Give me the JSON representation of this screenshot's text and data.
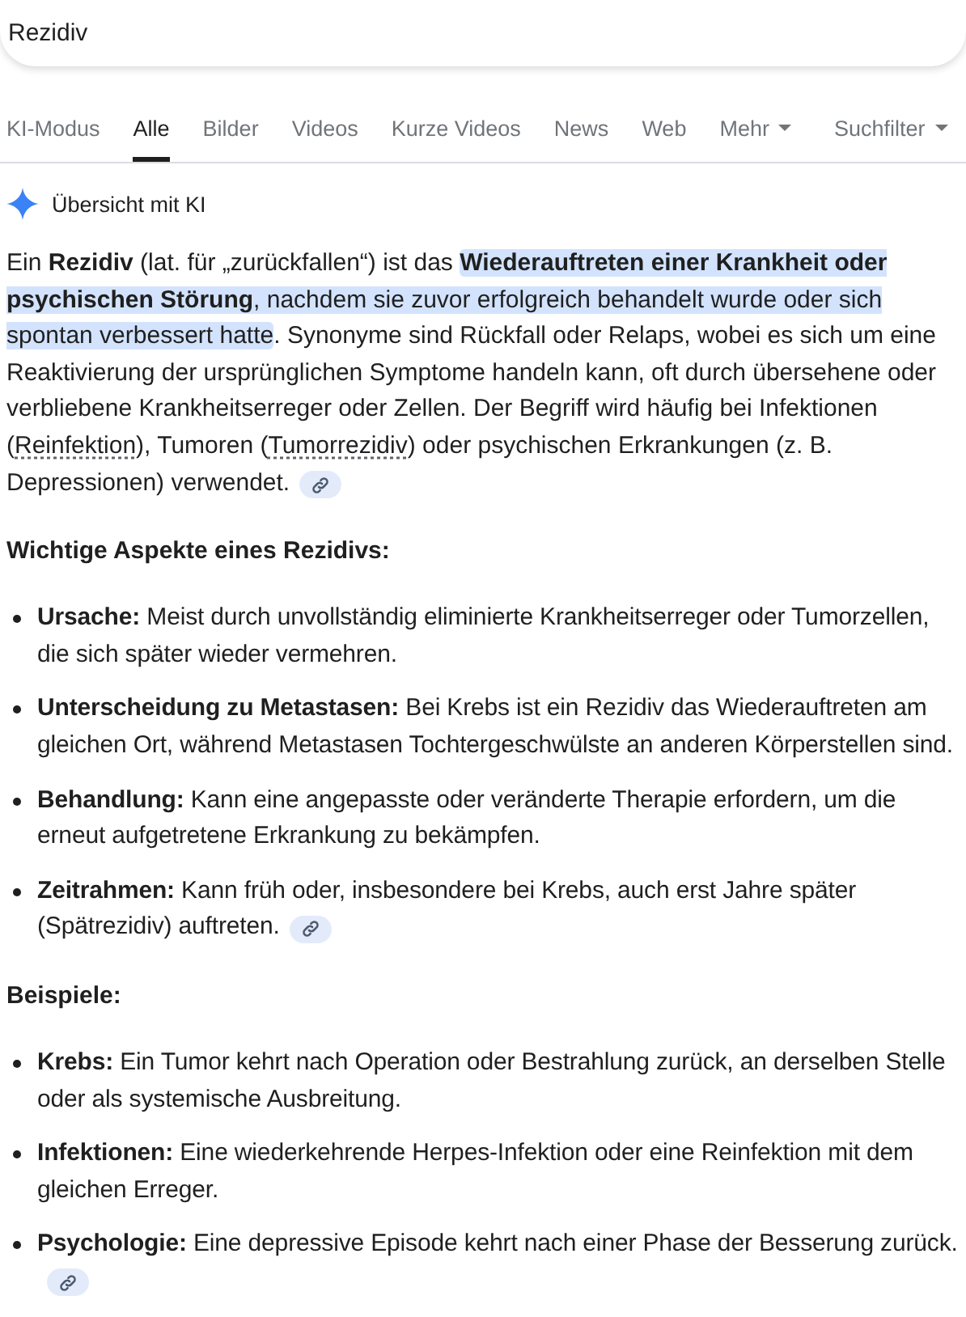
{
  "search": {
    "value": "Rezidiv"
  },
  "tabs": [
    {
      "label": "KI-Modus",
      "selected": false,
      "kind": "plain"
    },
    {
      "label": "Alle",
      "selected": true,
      "kind": "plain"
    },
    {
      "label": "Bilder",
      "selected": false,
      "kind": "plain"
    },
    {
      "label": "Videos",
      "selected": false,
      "kind": "plain"
    },
    {
      "label": "Kurze Videos",
      "selected": false,
      "kind": "plain"
    },
    {
      "label": "News",
      "selected": false,
      "kind": "plain"
    },
    {
      "label": "Web",
      "selected": false,
      "kind": "plain"
    },
    {
      "label": "Mehr",
      "selected": false,
      "kind": "dropdown"
    },
    {
      "label": "Suchfilter",
      "selected": false,
      "kind": "dropdown"
    }
  ],
  "overview": {
    "title": "Übersicht mit KI"
  },
  "intro": {
    "cited": true,
    "segments": [
      {
        "kind": "plain",
        "text": "Ein **Rezidiv** (lat. für „zurückfallen“) ist das "
      },
      {
        "kind": "highlight",
        "text": "**Wiederauftreten einer Krankheit oder psychischen Störung**, nachdem sie zuvor erfolgreich behandelt wurde oder sich spontan verbessert hatte"
      },
      {
        "kind": "plain",
        "text": ". Synonyme sind Rückfall oder Relaps, wobei es sich um eine Reaktivierung der ursprünglichen Symptome handeln kann, oft durch übersehene oder verbliebene Krankheitserreger oder Zellen. Der Begriff wird häufig bei Infektionen ("
      },
      {
        "kind": "term",
        "text": "Reinfektion"
      },
      {
        "kind": "plain",
        "text": "), Tumoren ("
      },
      {
        "kind": "term",
        "text": "Tumorrezidiv"
      },
      {
        "kind": "plain",
        "text": ") oder psychischen Erkrankungen (z. B. Depressionen) verwendet."
      }
    ]
  },
  "sections": [
    {
      "heading": "Wichtige Aspekte eines Rezidivs:",
      "items": [
        {
          "text": "**Ursache:** Meist durch unvollständig eliminierte Krankheitserreger oder Tumorzellen, die sich später wieder vermehren.",
          "cited": false
        },
        {
          "text": "**Unterscheidung zu Metastasen:** Bei Krebs ist ein Rezidiv das Wiederauftreten am gleichen Ort, während Metastasen Tochtergeschwülste an anderen Körperstellen sind.",
          "cited": false
        },
        {
          "text": "**Behandlung:** Kann eine angepasste oder veränderte Therapie erfordern, um die erneut aufgetretene Erkrankung zu bekämpfen.",
          "cited": false
        },
        {
          "text": "**Zeitrahmen:** Kann früh oder, insbesondere bei Krebs, auch erst Jahre später (Spätrezidiv) auftreten.",
          "cited": true
        }
      ]
    },
    {
      "heading": "Beispiele:",
      "items": [
        {
          "text": "**Krebs:** Ein Tumor kehrt nach Operation oder Bestrahlung zurück, an derselben Stelle oder als systemische Ausbreitung.",
          "cited": false
        },
        {
          "text": "**Infektionen:** Eine wiederkehrende Herpes-Infektion oder eine Reinfektion mit dem gleichen Erreger.",
          "cited": false
        },
        {
          "text": "**Psychologie:** Eine depressive Episode kehrt nach einer Phase der Besserung zurück.",
          "cited": true
        }
      ]
    }
  ]
}
